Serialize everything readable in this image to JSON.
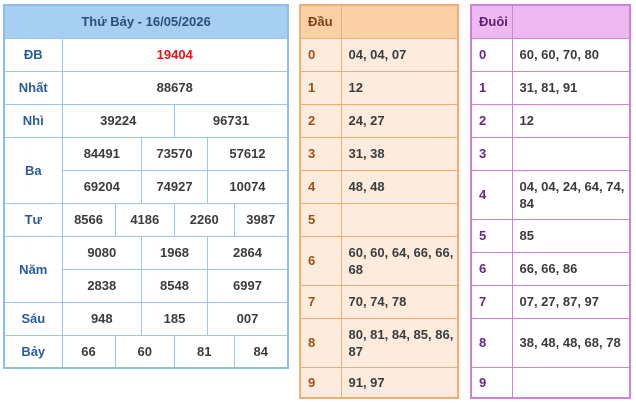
{
  "results": {
    "title": "Thứ Bảy - 16/05/2026",
    "rows": {
      "db": {
        "label": "ĐB",
        "values": [
          "19404"
        ]
      },
      "nhat": {
        "label": "Nhất",
        "values": [
          "88678"
        ]
      },
      "nhi": {
        "label": "Nhì",
        "values": [
          "39224",
          "96731"
        ]
      },
      "ba": {
        "label": "Ba",
        "values": [
          "84491",
          "73570",
          "57612",
          "69204",
          "74927",
          "10074"
        ]
      },
      "tu": {
        "label": "Tư",
        "values": [
          "8566",
          "4186",
          "2260",
          "3987"
        ]
      },
      "nam": {
        "label": "Năm",
        "values": [
          "9080",
          "1968",
          "2864",
          "2838",
          "8548",
          "6997"
        ]
      },
      "sau": {
        "label": "Sáu",
        "values": [
          "948",
          "185",
          "007"
        ]
      },
      "bay": {
        "label": "Bảy",
        "values": [
          "66",
          "60",
          "81",
          "84"
        ]
      }
    }
  },
  "dau": {
    "header": "Đầu",
    "rows": [
      {
        "idx": "0",
        "vals": "04, 04, 07"
      },
      {
        "idx": "1",
        "vals": "12"
      },
      {
        "idx": "2",
        "vals": "24, 27"
      },
      {
        "idx": "3",
        "vals": "31, 38"
      },
      {
        "idx": "4",
        "vals": "48, 48"
      },
      {
        "idx": "5",
        "vals": ""
      },
      {
        "idx": "6",
        "vals": "60, 60, 64, 66, 66, 68"
      },
      {
        "idx": "7",
        "vals": "70, 74, 78"
      },
      {
        "idx": "8",
        "vals": "80, 81, 84, 85, 86, 87"
      },
      {
        "idx": "9",
        "vals": "91, 97"
      }
    ]
  },
  "duoi": {
    "header": "Đuôi",
    "rows": [
      {
        "idx": "0",
        "vals": "60, 60, 70, 80"
      },
      {
        "idx": "1",
        "vals": "31, 81, 91"
      },
      {
        "idx": "2",
        "vals": "12"
      },
      {
        "idx": "3",
        "vals": ""
      },
      {
        "idx": "4",
        "vals": "04, 04, 24, 64, 74, 84"
      },
      {
        "idx": "5",
        "vals": "85"
      },
      {
        "idx": "6",
        "vals": "66, 66, 86"
      },
      {
        "idx": "7",
        "vals": "07, 27, 87, 97"
      },
      {
        "idx": "8",
        "vals": "38, 48, 48, 68, 78"
      },
      {
        "idx": "9",
        "vals": ""
      }
    ]
  },
  "colors": {
    "results_header": "#a7cff2",
    "results_border": "#8fbde6",
    "special_prize": "#e8141a",
    "dau_header": "#fbd0a6",
    "dau_body": "#fdecde",
    "duoi_header": "#ecb9f1"
  }
}
